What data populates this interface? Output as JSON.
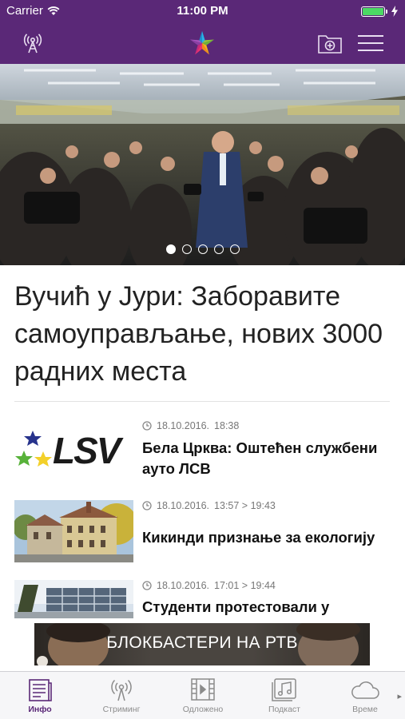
{
  "status_bar": {
    "carrier": "Carrier",
    "time": "11:00 PM"
  },
  "colors": {
    "brand": "#5a2877",
    "battery": "#4cd964",
    "tab_inactive": "#8b8b8b"
  },
  "nav": {
    "left_icon": "broadcast-tower-icon",
    "logo": "star-logo",
    "add_icon": "folder-add-icon",
    "menu_icon": "hamburger-menu-icon"
  },
  "hero": {
    "slides": 5,
    "active_slide": 1
  },
  "headline": "Вучић у Јури: Заборавите самоуправљање, нових 3000 радних места",
  "news": [
    {
      "date": "18.10.2016.",
      "time": "18:38",
      "title": "Бела Црква: Оштећен службени ауто ЛСВ",
      "logo_text": "LSV"
    },
    {
      "date": "18.10.2016.",
      "time": "13:57 > 19:43",
      "title": "Кикинди признање за екологију"
    },
    {
      "date": "18.10.2016.",
      "time": "17:01 > 19:44",
      "title": "Студенти протестовали у"
    }
  ],
  "banner": {
    "text": "БЛОКБАСТЕРИ НА РТВ"
  },
  "tabs": [
    {
      "label": "Инфо",
      "icon": "newspaper-icon",
      "active": true
    },
    {
      "label": "Стриминг",
      "icon": "streaming-icon",
      "active": false
    },
    {
      "label": "Одложено",
      "icon": "film-icon",
      "active": false
    },
    {
      "label": "Подкаст",
      "icon": "music-icon",
      "active": false
    },
    {
      "label": "Време",
      "icon": "cloud-icon",
      "active": false
    }
  ],
  "tab_more": "▸"
}
